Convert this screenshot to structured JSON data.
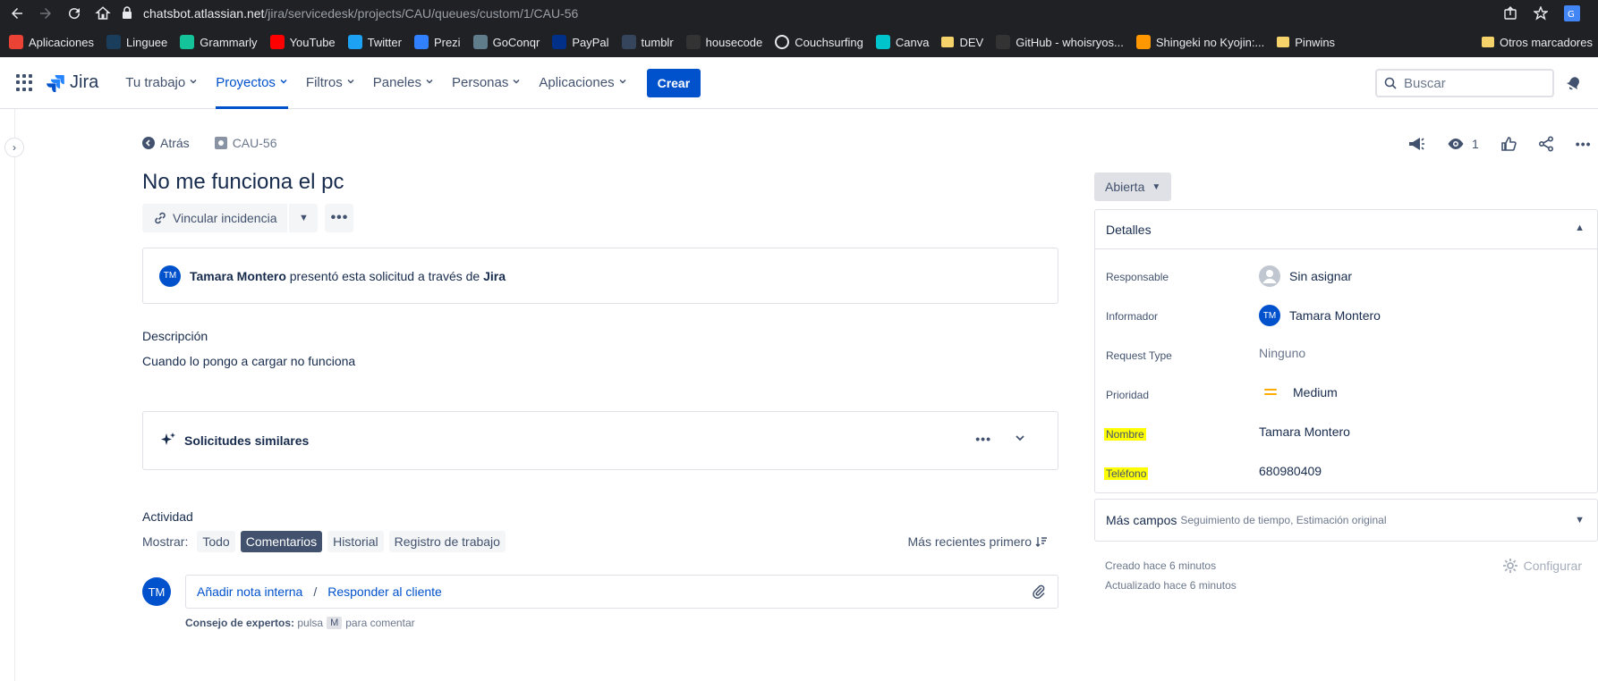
{
  "browser": {
    "url_host": "chatsbot.atlassian.net",
    "url_path": "/jira/servicedesk/projects/CAU/queues/custom/1/CAU-56",
    "bookmarks": [
      {
        "label": "Aplicaciones",
        "icon": "apps-icon",
        "color": "#ea4335"
      },
      {
        "label": "Linguee",
        "icon": "linguee-icon",
        "color": "#1a3d5c"
      },
      {
        "label": "Grammarly",
        "icon": "grammarly-icon",
        "color": "#15c39a"
      },
      {
        "label": "YouTube",
        "icon": "youtube-icon",
        "color": "#ff0000"
      },
      {
        "label": "Twitter",
        "icon": "twitter-icon",
        "color": "#1da1f2"
      },
      {
        "label": "Prezi",
        "icon": "prezi-icon",
        "color": "#3181ff"
      },
      {
        "label": "GoConqr",
        "icon": "goconqr-icon",
        "color": "#607d8b"
      },
      {
        "label": "PayPal",
        "icon": "paypal-icon",
        "color": "#003087"
      },
      {
        "label": "tumblr",
        "icon": "tumblr-icon",
        "color": "#35465c"
      },
      {
        "label": "housecode",
        "icon": "github-icon",
        "color": "#333333"
      },
      {
        "label": "Couchsurfing",
        "icon": "couchsurfing-icon",
        "color": "#ffffff"
      },
      {
        "label": "Canva",
        "icon": "canva-icon",
        "color": "#00c4cc"
      },
      {
        "label": "DEV",
        "icon": "folder-icon",
        "color": "#f6d36a"
      },
      {
        "label": "GitHub - whoisryos...",
        "icon": "github-icon",
        "color": "#333333"
      },
      {
        "label": "Shingeki no Kyojin:...",
        "icon": "af-icon",
        "color": "#ff9800"
      },
      {
        "label": "Pinwins",
        "icon": "folder-icon",
        "color": "#f6d36a"
      }
    ],
    "other_bookmarks": "Otros marcadores"
  },
  "nav": {
    "logo": "Jira",
    "items": [
      {
        "label": "Tu trabajo",
        "active": false
      },
      {
        "label": "Proyectos",
        "active": true
      },
      {
        "label": "Filtros",
        "active": false
      },
      {
        "label": "Paneles",
        "active": false
      },
      {
        "label": "Personas",
        "active": false
      },
      {
        "label": "Aplicaciones",
        "active": false
      }
    ],
    "create": "Crear",
    "search_placeholder": "Buscar"
  },
  "issue": {
    "back": "Atrás",
    "key": "CAU-56",
    "title": "No me funciona el pc",
    "link_issue": "Vincular incidencia",
    "requester": "Tamara Montero",
    "requester_initials": "TM",
    "request_text": "presentó esta solicitud a través de",
    "request_channel": "Jira",
    "description_label": "Descripción",
    "description": "Cuando lo pongo a cargar no funciona",
    "similar": "Solicitudes similares",
    "activity_label": "Actividad",
    "show_label": "Mostrar:",
    "filters": [
      {
        "label": "Todo",
        "active": false
      },
      {
        "label": "Comentarios",
        "active": true
      },
      {
        "label": "Historial",
        "active": false
      },
      {
        "label": "Registro de trabajo",
        "active": false
      }
    ],
    "sort": "Más recientes primero",
    "internal_note": "Añadir nota interna",
    "separator": "/",
    "reply": "Responder al cliente",
    "tip_label": "Consejo de expertos:",
    "tip_press": "pulsa",
    "tip_key": "M",
    "tip_action": "para comentar"
  },
  "sidepanel": {
    "watchers": "1",
    "status": "Abierta",
    "details_title": "Detalles",
    "fields": [
      {
        "label": "Responsable",
        "value": "Sin asignar"
      },
      {
        "label": "Informador",
        "value": "Tamara Montero"
      },
      {
        "label": "Request Type",
        "value": "Ninguno"
      },
      {
        "label": "Prioridad",
        "value": "Medium"
      },
      {
        "label": "Nombre",
        "value": "Tamara Montero"
      },
      {
        "label": "Teléfono",
        "value": "680980409"
      }
    ],
    "more_fields": "Más campos",
    "more_fields_sub": "Seguimiento de tiempo, Estimación original",
    "created": "Creado hace 6 minutos",
    "updated": "Actualizado hace 6 minutos",
    "configure": "Configurar"
  },
  "colors": {
    "accent": "#0052cc",
    "highlight": "#ffff00",
    "priority_medium": "#ffab00"
  }
}
